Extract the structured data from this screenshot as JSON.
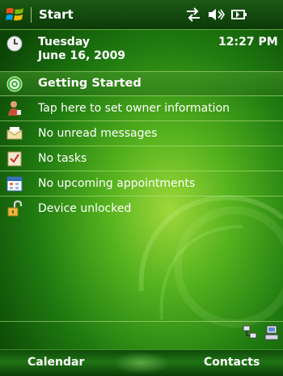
{
  "titlebar": {
    "title": "Start",
    "status_icons": [
      "connectivity-icon",
      "volume-icon",
      "battery-icon"
    ]
  },
  "date": {
    "day": "Tuesday",
    "date": "June 16, 2009",
    "time": "12:27 PM"
  },
  "items": [
    {
      "label": "Getting Started",
      "icon": "getting-started-icon"
    },
    {
      "label": "Tap here to set owner information",
      "icon": "owner-icon"
    },
    {
      "label": "No unread messages",
      "icon": "messages-icon"
    },
    {
      "label": "No tasks",
      "icon": "tasks-icon"
    },
    {
      "label": "No upcoming appointments",
      "icon": "calendar-icon"
    },
    {
      "label": "Device unlocked",
      "icon": "unlock-icon"
    }
  ],
  "tray_icons": [
    "network-icon",
    "activesync-icon"
  ],
  "softkeys": {
    "left": "Calendar",
    "right": "Contacts"
  },
  "colors": {
    "background_center": "#9fd83a",
    "background_edge": "#0b4506",
    "titlebar": "#0c3a08",
    "separator": "#5da83a"
  }
}
